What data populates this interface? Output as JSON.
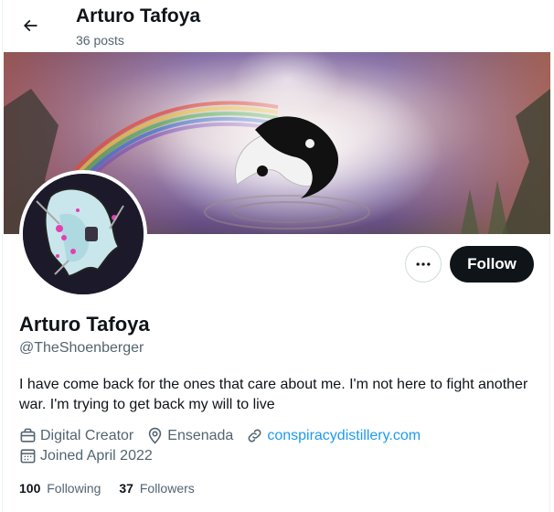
{
  "header": {
    "back_icon": "arrow-left-icon",
    "title": "Arturo Tafoya",
    "post_count": "36 posts"
  },
  "profile": {
    "display_name": "Arturo Tafoya",
    "handle": "@TheShoenberger",
    "bio": "I have come back for the ones that care about me. I'm not here to fight another war. I'm trying to get back my will to live",
    "category": "Digital Creator",
    "location": "Ensenada",
    "website": "conspiracydistillery.com",
    "joined": "Joined April 2022",
    "following_count": "100",
    "following_label": "Following",
    "followers_count": "37",
    "followers_label": "Followers"
  },
  "actions": {
    "more_icon": "more-dots-icon",
    "follow_label": "Follow"
  },
  "colors": {
    "accent": "#1d9bf0",
    "text_primary": "#0f1419",
    "text_secondary": "#536471",
    "button_dark": "#0f1419"
  }
}
